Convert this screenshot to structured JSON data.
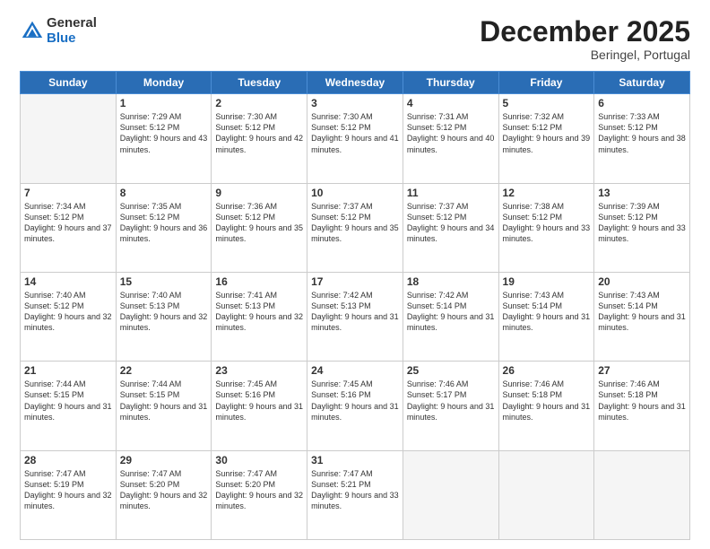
{
  "logo": {
    "general": "General",
    "blue": "Blue"
  },
  "header": {
    "month": "December 2025",
    "location": "Beringel, Portugal"
  },
  "days_of_week": [
    "Sunday",
    "Monday",
    "Tuesday",
    "Wednesday",
    "Thursday",
    "Friday",
    "Saturday"
  ],
  "weeks": [
    [
      {
        "day": "",
        "empty": true
      },
      {
        "day": "1",
        "sunrise": "7:29 AM",
        "sunset": "5:12 PM",
        "daylight": "9 hours and 43 minutes."
      },
      {
        "day": "2",
        "sunrise": "7:30 AM",
        "sunset": "5:12 PM",
        "daylight": "9 hours and 42 minutes."
      },
      {
        "day": "3",
        "sunrise": "7:30 AM",
        "sunset": "5:12 PM",
        "daylight": "9 hours and 41 minutes."
      },
      {
        "day": "4",
        "sunrise": "7:31 AM",
        "sunset": "5:12 PM",
        "daylight": "9 hours and 40 minutes."
      },
      {
        "day": "5",
        "sunrise": "7:32 AM",
        "sunset": "5:12 PM",
        "daylight": "9 hours and 39 minutes."
      },
      {
        "day": "6",
        "sunrise": "7:33 AM",
        "sunset": "5:12 PM",
        "daylight": "9 hours and 38 minutes."
      }
    ],
    [
      {
        "day": "7",
        "sunrise": "7:34 AM",
        "sunset": "5:12 PM",
        "daylight": "9 hours and 37 minutes."
      },
      {
        "day": "8",
        "sunrise": "7:35 AM",
        "sunset": "5:12 PM",
        "daylight": "9 hours and 36 minutes."
      },
      {
        "day": "9",
        "sunrise": "7:36 AM",
        "sunset": "5:12 PM",
        "daylight": "9 hours and 35 minutes."
      },
      {
        "day": "10",
        "sunrise": "7:37 AM",
        "sunset": "5:12 PM",
        "daylight": "9 hours and 35 minutes."
      },
      {
        "day": "11",
        "sunrise": "7:37 AM",
        "sunset": "5:12 PM",
        "daylight": "9 hours and 34 minutes."
      },
      {
        "day": "12",
        "sunrise": "7:38 AM",
        "sunset": "5:12 PM",
        "daylight": "9 hours and 33 minutes."
      },
      {
        "day": "13",
        "sunrise": "7:39 AM",
        "sunset": "5:12 PM",
        "daylight": "9 hours and 33 minutes."
      }
    ],
    [
      {
        "day": "14",
        "sunrise": "7:40 AM",
        "sunset": "5:12 PM",
        "daylight": "9 hours and 32 minutes."
      },
      {
        "day": "15",
        "sunrise": "7:40 AM",
        "sunset": "5:13 PM",
        "daylight": "9 hours and 32 minutes."
      },
      {
        "day": "16",
        "sunrise": "7:41 AM",
        "sunset": "5:13 PM",
        "daylight": "9 hours and 32 minutes."
      },
      {
        "day": "17",
        "sunrise": "7:42 AM",
        "sunset": "5:13 PM",
        "daylight": "9 hours and 31 minutes."
      },
      {
        "day": "18",
        "sunrise": "7:42 AM",
        "sunset": "5:14 PM",
        "daylight": "9 hours and 31 minutes."
      },
      {
        "day": "19",
        "sunrise": "7:43 AM",
        "sunset": "5:14 PM",
        "daylight": "9 hours and 31 minutes."
      },
      {
        "day": "20",
        "sunrise": "7:43 AM",
        "sunset": "5:14 PM",
        "daylight": "9 hours and 31 minutes."
      }
    ],
    [
      {
        "day": "21",
        "sunrise": "7:44 AM",
        "sunset": "5:15 PM",
        "daylight": "9 hours and 31 minutes."
      },
      {
        "day": "22",
        "sunrise": "7:44 AM",
        "sunset": "5:15 PM",
        "daylight": "9 hours and 31 minutes."
      },
      {
        "day": "23",
        "sunrise": "7:45 AM",
        "sunset": "5:16 PM",
        "daylight": "9 hours and 31 minutes."
      },
      {
        "day": "24",
        "sunrise": "7:45 AM",
        "sunset": "5:16 PM",
        "daylight": "9 hours and 31 minutes."
      },
      {
        "day": "25",
        "sunrise": "7:46 AM",
        "sunset": "5:17 PM",
        "daylight": "9 hours and 31 minutes."
      },
      {
        "day": "26",
        "sunrise": "7:46 AM",
        "sunset": "5:18 PM",
        "daylight": "9 hours and 31 minutes."
      },
      {
        "day": "27",
        "sunrise": "7:46 AM",
        "sunset": "5:18 PM",
        "daylight": "9 hours and 31 minutes."
      }
    ],
    [
      {
        "day": "28",
        "sunrise": "7:47 AM",
        "sunset": "5:19 PM",
        "daylight": "9 hours and 32 minutes."
      },
      {
        "day": "29",
        "sunrise": "7:47 AM",
        "sunset": "5:20 PM",
        "daylight": "9 hours and 32 minutes."
      },
      {
        "day": "30",
        "sunrise": "7:47 AM",
        "sunset": "5:20 PM",
        "daylight": "9 hours and 32 minutes."
      },
      {
        "day": "31",
        "sunrise": "7:47 AM",
        "sunset": "5:21 PM",
        "daylight": "9 hours and 33 minutes."
      },
      {
        "day": "",
        "empty": true
      },
      {
        "day": "",
        "empty": true
      },
      {
        "day": "",
        "empty": true
      }
    ]
  ]
}
